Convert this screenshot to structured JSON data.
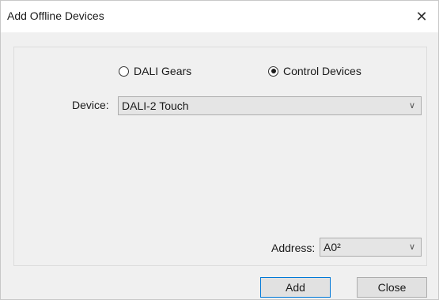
{
  "window": {
    "title": "Add Offline Devices",
    "close_glyph": "✕"
  },
  "radio_group": {
    "options": [
      {
        "label": "DALI Gears",
        "checked": false
      },
      {
        "label": "Control Devices",
        "checked": true
      }
    ]
  },
  "device": {
    "label": "Device:",
    "value": "DALI-2 Touch"
  },
  "address": {
    "label": "Address:",
    "value": "A0²"
  },
  "buttons": {
    "add_label": "Add",
    "close_label": "Close"
  },
  "icons": {
    "dropdown": "chevron-down-icon",
    "close": "close-icon"
  },
  "colors": {
    "dialog_bg": "#f0f0f0",
    "titlebar_bg": "#ffffff",
    "default_button_border": "#0078d7"
  }
}
